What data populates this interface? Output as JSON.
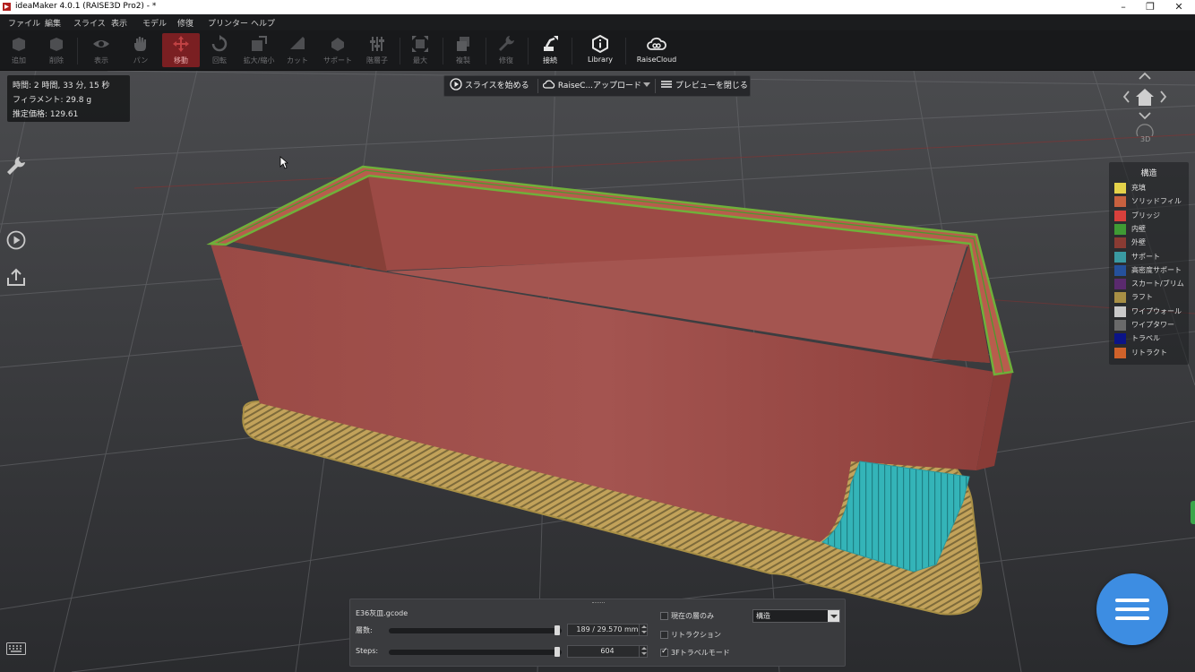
{
  "window": {
    "title": "ideaMaker 4.0.1 (RAISE3D Pro2) - *",
    "controls": [
      "–",
      "❐",
      "✕"
    ]
  },
  "menu": [
    "ファイル",
    "編集",
    "スライス",
    "表示",
    "モデル",
    "修復",
    "プリンター",
    "ヘルプ"
  ],
  "toolbar": {
    "add": "追加",
    "delete": "削除",
    "view": "表示",
    "pan": "パン",
    "move": "移動",
    "rotate": "回転",
    "scale": "拡大/縮小",
    "cut": "カット",
    "support": "サポート",
    "layering": "階層子",
    "max": "最大",
    "duplicate": "複製",
    "repair": "修復",
    "connect": "接続",
    "library": "Library",
    "raisecloud": "RaiseCloud",
    "active_tool": "move"
  },
  "print_info": {
    "time": "時間: 2 時間, 33 分, 15 秒",
    "filament": "フィラメント: 29.8 g",
    "cost": "推定価格: 129.61"
  },
  "slice_bar": {
    "start_slice": "スライスを始める",
    "upload": "RaiseC...アップロード",
    "close_preview": "プレビューを閉じる"
  },
  "nav": {
    "view_mode": "3D"
  },
  "legend": {
    "title": "構造",
    "items": [
      {
        "label": "充填",
        "color": "#e4d24a"
      },
      {
        "label": "ソリッドフィル",
        "color": "#c8613f"
      },
      {
        "label": "ブリッジ",
        "color": "#d8403c"
      },
      {
        "label": "内壁",
        "color": "#3f9b34"
      },
      {
        "label": "外壁",
        "color": "#8a3b33"
      },
      {
        "label": "サポート",
        "color": "#3a9aa2"
      },
      {
        "label": "高密度サポート",
        "color": "#25519c"
      },
      {
        "label": "スカート/ブリム",
        "color": "#5a2a6e"
      },
      {
        "label": "ラフト",
        "color": "#a88f45"
      },
      {
        "label": "ワイプウォール",
        "color": "#c9c9c9"
      },
      {
        "label": "ワイプタワー",
        "color": "#6a6a6a"
      },
      {
        "label": "トラベル",
        "color": "#0b1487"
      },
      {
        "label": "リトラクト",
        "color": "#d0622a"
      }
    ]
  },
  "preview_panel": {
    "filename": "E36灰皿.gcode",
    "layer_label": "層数:",
    "layer_value": "189 / 29.570 mm",
    "layer_fraction": 1.0,
    "steps_label": "Steps:",
    "steps_value": "604",
    "steps_fraction": 1.0,
    "current_layer_only": {
      "label": "現在の層のみ",
      "checked": false
    },
    "retraction": {
      "label": "リトラクション",
      "checked": false
    },
    "travel_3f": {
      "label": "3Fトラベルモード",
      "checked": true
    },
    "view_select": "構造"
  },
  "colors": {
    "model_wall": "#a0514c",
    "raft": "#c2a25a",
    "support": "#34b4b8",
    "accent_blue": "#3d8de2",
    "active_tool_red": "#7a1f22"
  }
}
